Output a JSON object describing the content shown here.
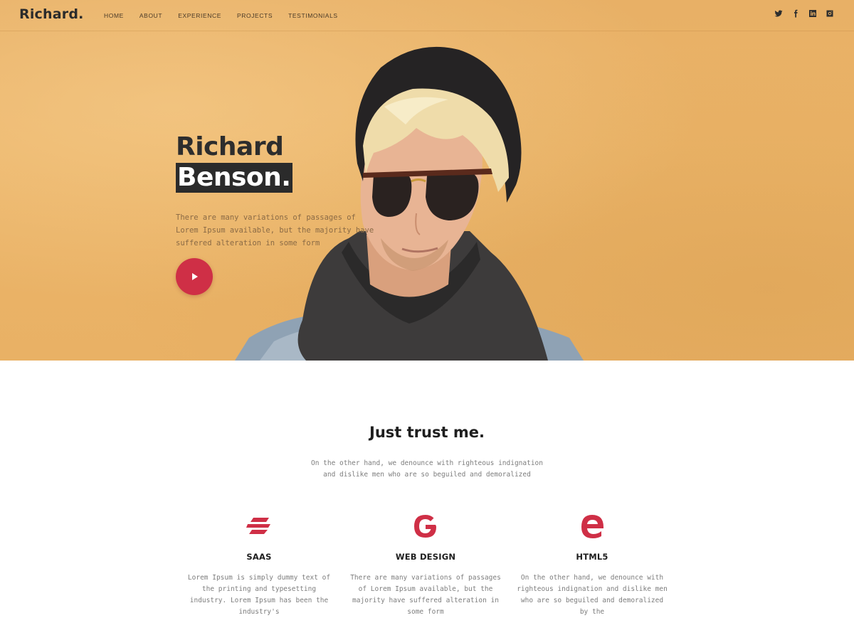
{
  "brand": {
    "logo": "Richard."
  },
  "nav": {
    "items": [
      {
        "label": "HOME"
      },
      {
        "label": "ABOUT"
      },
      {
        "label": "EXPERIENCE"
      },
      {
        "label": "PROJECTS"
      },
      {
        "label": "TESTIMONIALS"
      }
    ],
    "socials": [
      "twitter-icon",
      "facebook-icon",
      "linkedin-icon",
      "instagram-icon"
    ]
  },
  "hero": {
    "first_name": "Richard",
    "last_name": "Benson.",
    "description": "There are many variations of passages of Lorem Ipsum available, but the majority have suffered alteration in some form",
    "play_icon": "play-icon",
    "background_color": "#ebb468",
    "accent_color": "#cf2f46"
  },
  "trust": {
    "title": "Just trust me.",
    "subtitle": "On the other hand, we denounce with righteous indignation and dislike men who are so beguiled and demoralized",
    "features": [
      {
        "icon": "saas-icon",
        "title": "SAAS",
        "description": "Lorem Ipsum is simply dummy text of the printing and typesetting industry. Lorem Ipsum has been the industry's"
      },
      {
        "icon": "google-icon",
        "title": "WEB DESIGN",
        "description": "There are many variations of passages of Lorem Ipsum available, but the majority have suffered alteration in some form"
      },
      {
        "icon": "edge-icon",
        "title": "HTML5",
        "description": "On the other hand, we denounce with righteous indignation and dislike men who are so beguiled and demoralized by the"
      }
    ]
  }
}
